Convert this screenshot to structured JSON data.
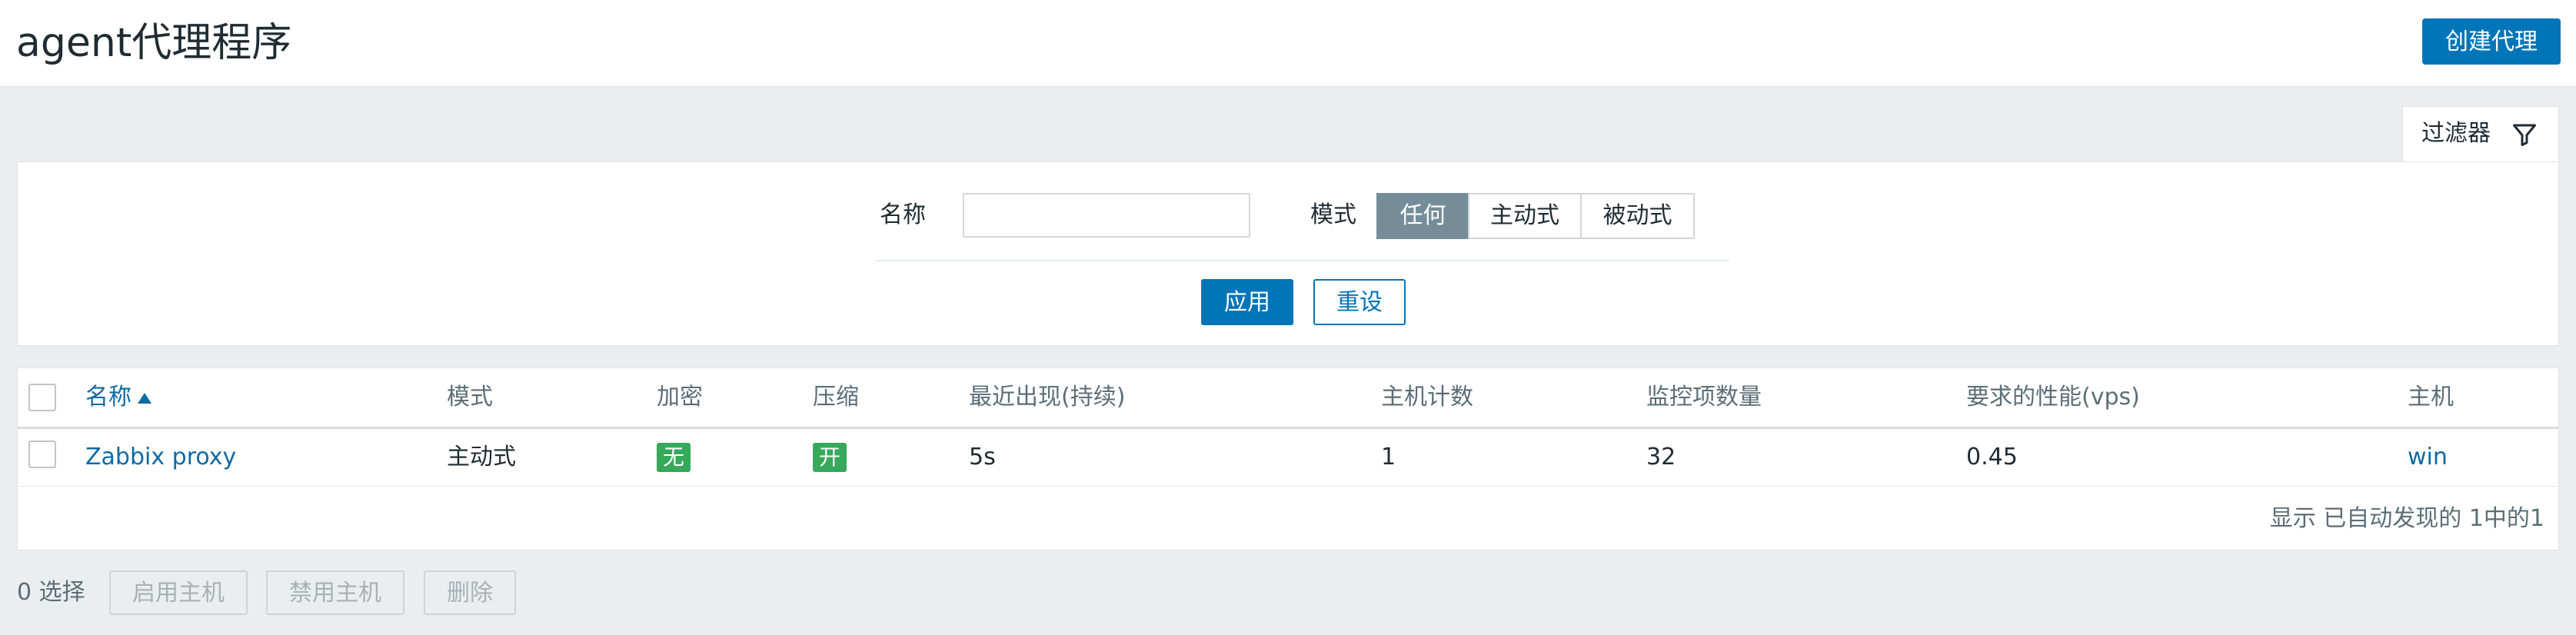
{
  "header": {
    "title": "agent代理程序",
    "create_button": "创建代理"
  },
  "filter": {
    "tab_label": "过滤器",
    "tab_icon": "filter-icon",
    "name_label": "名称",
    "name_value": "",
    "mode_label": "模式",
    "mode_options": [
      "任何",
      "主动式",
      "被动式"
    ],
    "mode_selected": "任何",
    "apply_label": "应用",
    "reset_label": "重设"
  },
  "table": {
    "columns": [
      "名称",
      "模式",
      "加密",
      "压缩",
      "最近出现(持续)",
      "主机计数",
      "监控项数量",
      "要求的性能(vps)",
      "主机"
    ],
    "sort_column": "名称",
    "sort_direction": "ascending",
    "rows": [
      {
        "name": "Zabbix proxy",
        "mode": "主动式",
        "encryption": "无",
        "compression": "开",
        "last_seen": "5s",
        "host_count": "1",
        "item_count": "32",
        "required_performance": "0.45",
        "hosts": "win"
      }
    ],
    "footer": "显示 已自动发现的 1中的1"
  },
  "bottom": {
    "selected": "0 选择",
    "enable_hosts": "启用主机",
    "disable_hosts": "禁用主机",
    "delete": "删除"
  },
  "colors": {
    "accent": "#0275b8",
    "tag_green": "#36a95b",
    "segment_active": "#768d99",
    "background": "#ebeef0"
  }
}
